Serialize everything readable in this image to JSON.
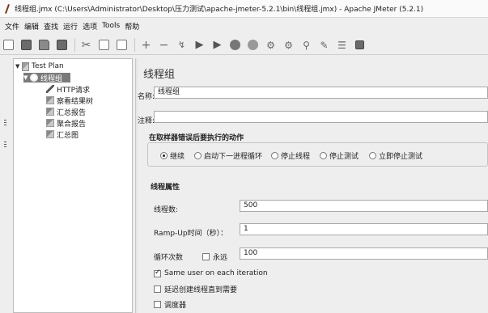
{
  "window": {
    "title": "线程组.jmx (C:\\Users\\Administrator\\Desktop\\压力测试\\apache-jmeter-5.2.1\\bin\\线程组.jmx) - Apache JMeter (5.2.1)"
  },
  "menu": [
    "文件",
    "编辑",
    "查找",
    "运行",
    "选项",
    "Tools",
    "帮助"
  ],
  "toolbar": {
    "icons": [
      "new-icon",
      "templates-icon",
      "open-icon",
      "save-icon",
      "cut-icon",
      "copy-icon",
      "paste-icon",
      "expand-icon",
      "collapse-icon",
      "toggle-icon",
      "start-icon",
      "start-no-pause-icon",
      "stop-icon",
      "shutdown-icon",
      "clear-icon",
      "clear-all-icon",
      "search-icon",
      "reset-search-icon",
      "function-helper-icon",
      "help-icon"
    ]
  },
  "tree": {
    "items": [
      {
        "label": "Test Plan",
        "icon": "test-plan-icon",
        "expanded": true
      },
      {
        "label": "线程组",
        "icon": "thread-group-icon",
        "selected": true,
        "expanded": true
      },
      {
        "label": "HTTP请求",
        "icon": "sampler-pen-icon"
      },
      {
        "label": "察看结果树",
        "icon": "listener-icon"
      },
      {
        "label": "汇总报告",
        "icon": "listener-icon"
      },
      {
        "label": "聚合报告",
        "icon": "listener-icon"
      },
      {
        "label": "汇总图",
        "icon": "listener-icon"
      }
    ]
  },
  "panel": {
    "title": "线程组",
    "name_label": "名称:",
    "name_value": "线程组",
    "comment_label": "注释:",
    "comment_value": "",
    "sampler_error_section": "在取样器错误后要执行的动作",
    "error_actions": [
      {
        "label": "继续",
        "selected": true
      },
      {
        "label": "启动下一进程循环",
        "selected": false
      },
      {
        "label": "停止线程",
        "selected": false
      },
      {
        "label": "停止测试",
        "selected": false
      },
      {
        "label": "立即停止测试",
        "selected": false
      }
    ],
    "thread_props_section": "线程属性",
    "threads_label": "线程数:",
    "threads_value": "500",
    "rampup_label": "Ramp-Up时间（秒）：",
    "rampup_value": "1",
    "loop_label": "循环次数",
    "forever_label": "永远",
    "forever_checked": false,
    "loop_value": "100",
    "same_user_label": "Same user on each iteration",
    "same_user_checked": true,
    "delay_label": "延迟创建线程直到需要",
    "delay_checked": false,
    "scheduler_label": "调度器",
    "scheduler_checked": false
  }
}
